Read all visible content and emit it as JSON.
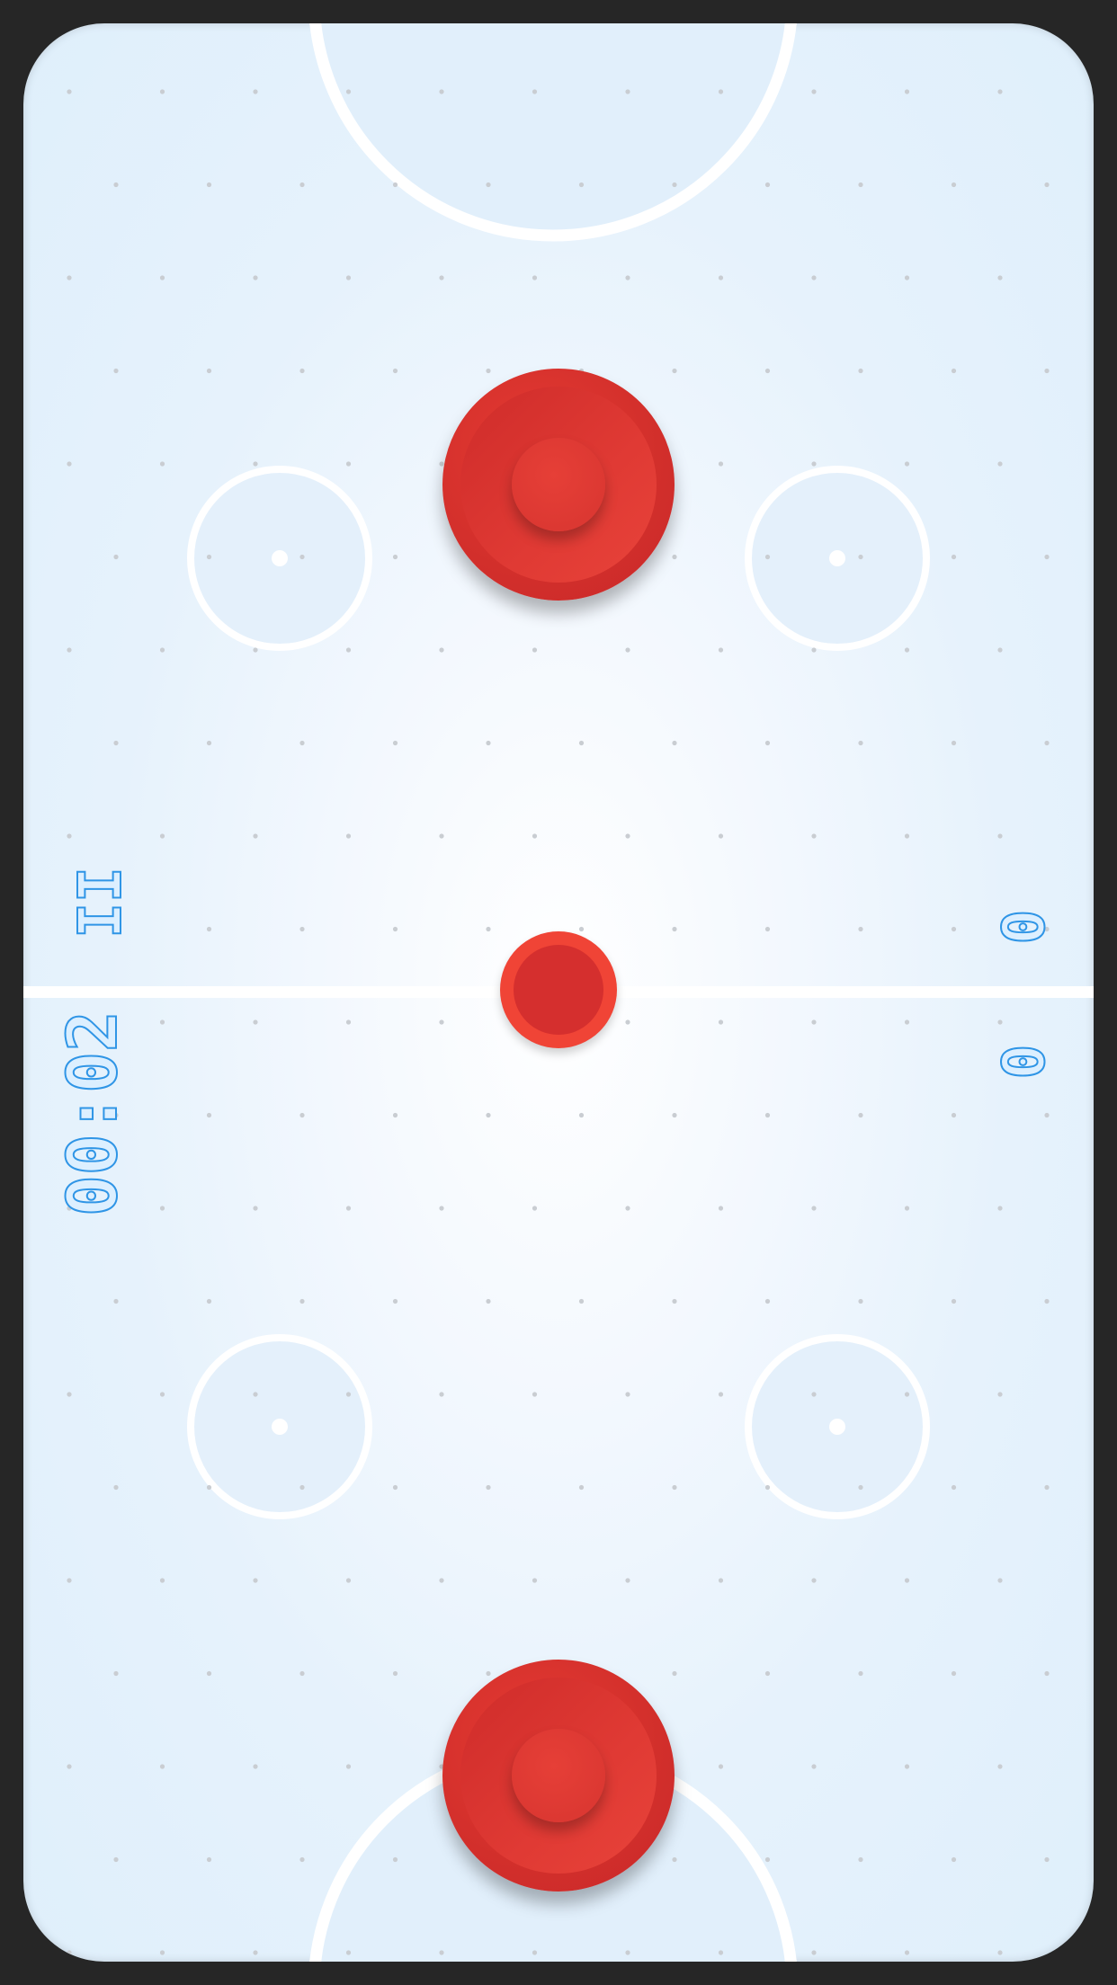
{
  "game": "air-hockey",
  "hud": {
    "pause_label": "II",
    "timer": "00:02",
    "score_top": "0",
    "score_bottom": "0"
  },
  "colors": {
    "background": "#262626",
    "rink_center": "#ffffff",
    "rink_edge": "#dfeffb",
    "line": "#ffffff",
    "paddle": "#d22f2b",
    "puck_outer": "#f04436",
    "puck_inner": "#d52f2e",
    "hud_text": "#2f95e6"
  }
}
